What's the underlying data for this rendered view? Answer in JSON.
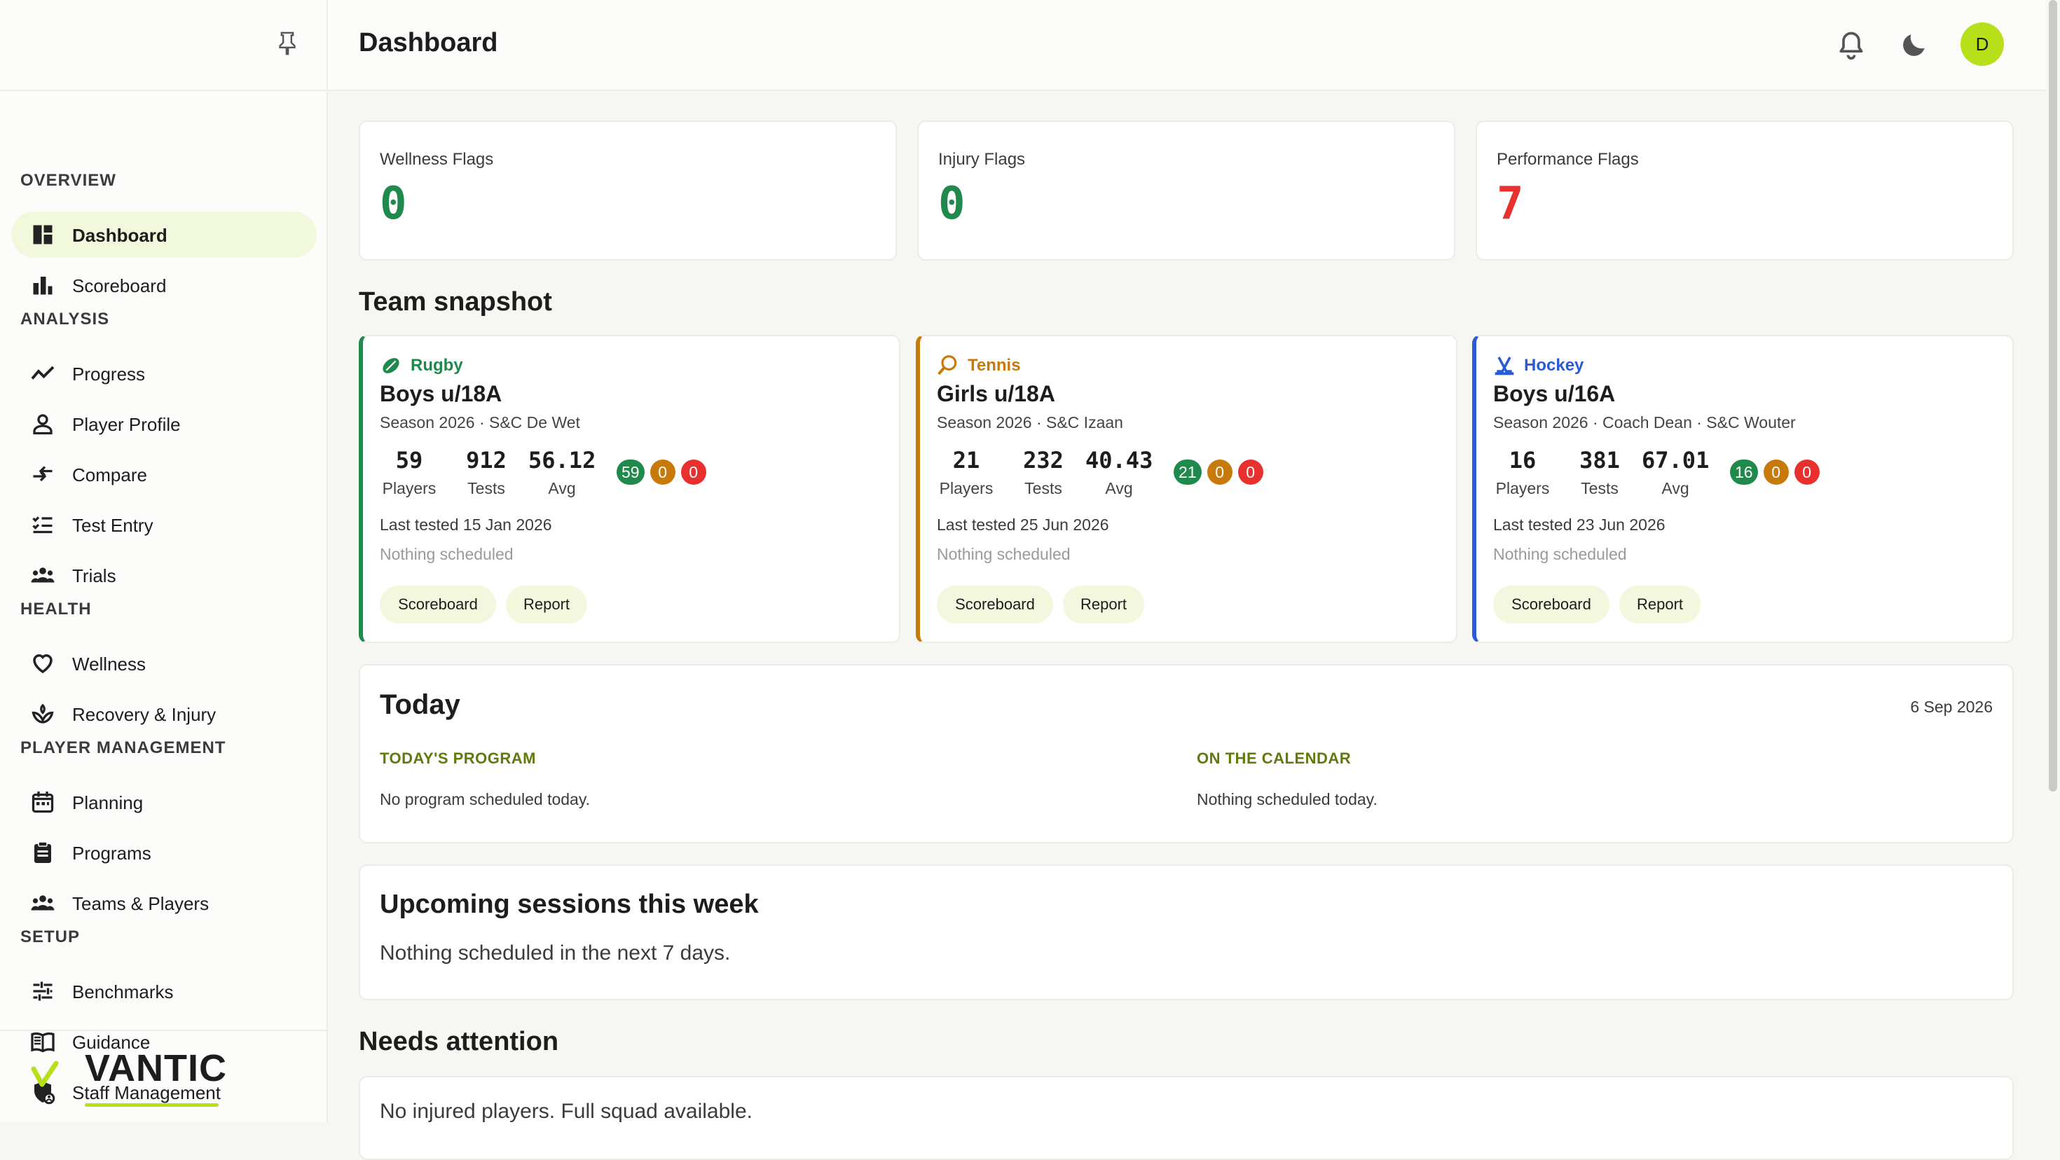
{
  "sidebar": {
    "sections": [
      {
        "title": "OVERVIEW",
        "items": [
          {
            "label": "Dashboard",
            "icon": "dashboard-icon",
            "active": true
          },
          {
            "label": "Scoreboard",
            "icon": "bar-chart-icon"
          }
        ]
      },
      {
        "title": "ANALYSIS",
        "items": [
          {
            "label": "Progress",
            "icon": "trend-line-icon"
          },
          {
            "label": "Player Profile",
            "icon": "person-icon"
          },
          {
            "label": "Compare",
            "icon": "compare-arrows-icon"
          },
          {
            "label": "Test Entry",
            "icon": "checklist-icon"
          },
          {
            "label": "Trials",
            "icon": "group-icon"
          }
        ]
      },
      {
        "title": "HEALTH",
        "items": [
          {
            "label": "Wellness",
            "icon": "heart-icon"
          },
          {
            "label": "Recovery & Injury",
            "icon": "recovery-icon"
          }
        ]
      },
      {
        "title": "PLAYER MANAGEMENT",
        "items": [
          {
            "label": "Planning",
            "icon": "calendar-icon"
          },
          {
            "label": "Programs",
            "icon": "clipboard-icon"
          },
          {
            "label": "Teams & Players",
            "icon": "group-icon"
          }
        ]
      },
      {
        "title": "SETUP",
        "items": [
          {
            "label": "Benchmarks",
            "icon": "sliders-icon"
          },
          {
            "label": "Guidance",
            "icon": "book-icon"
          },
          {
            "label": "Staff Management",
            "icon": "shield-person-icon"
          }
        ]
      }
    ],
    "brand": "VANTIC",
    "brand_color": "#b8e01a"
  },
  "header": {
    "title": "Dashboard",
    "avatar_initial": "D"
  },
  "flags": [
    {
      "label": "Wellness Flags",
      "value": "0",
      "color": "#1f8a4c"
    },
    {
      "label": "Injury Flags",
      "value": "0",
      "color": "#1f8a4c"
    },
    {
      "label": "Performance Flags",
      "value": "7",
      "color": "#e8312f"
    }
  ],
  "team_snapshot": {
    "title": "Team snapshot",
    "teams": [
      {
        "sport": "Rugby",
        "sport_color": "#1f8a4c",
        "name": "Boys u/18A",
        "sub": "Season 2026 · S&C De Wet",
        "stats": [
          {
            "num": "59",
            "cap": "Players"
          },
          {
            "num": "912",
            "cap": "Tests"
          },
          {
            "num": "56.12",
            "cap": "Avg"
          }
        ],
        "badges": [
          "59",
          "0",
          "0"
        ],
        "last_tested": "Last tested 15 Jan 2026",
        "scheduled": "Nothing scheduled",
        "buttons": [
          "Scoreboard",
          "Report"
        ]
      },
      {
        "sport": "Tennis",
        "sport_color": "#c77a0a",
        "name": "Girls u/18A",
        "sub": "Season 2026 · S&C Izaan",
        "stats": [
          {
            "num": "21",
            "cap": "Players"
          },
          {
            "num": "232",
            "cap": "Tests"
          },
          {
            "num": "40.43",
            "cap": "Avg"
          }
        ],
        "badges": [
          "21",
          "0",
          "0"
        ],
        "last_tested": "Last tested 25 Jun 2026",
        "scheduled": "Nothing scheduled",
        "buttons": [
          "Scoreboard",
          "Report"
        ]
      },
      {
        "sport": "Hockey",
        "sport_color": "#2a5bd7",
        "name": "Boys u/16A",
        "sub": "Season 2026 · Coach Dean · S&C Wouter",
        "stats": [
          {
            "num": "16",
            "cap": "Players"
          },
          {
            "num": "381",
            "cap": "Tests"
          },
          {
            "num": "67.01",
            "cap": "Avg"
          }
        ],
        "badges": [
          "16",
          "0",
          "0"
        ],
        "last_tested": "Last tested 23 Jun 2026",
        "scheduled": "Nothing scheduled",
        "buttons": [
          "Scoreboard",
          "Report"
        ]
      }
    ],
    "badge_colors": [
      "#1f8a4c",
      "#c77a0a",
      "#e8312f"
    ]
  },
  "today": {
    "title": "Today",
    "date": "6 Sep 2026",
    "program_title": "TODAY'S PROGRAM",
    "program_text": "No program scheduled today.",
    "calendar_title": "ON THE CALENDAR",
    "calendar_text": "Nothing scheduled today."
  },
  "upcoming": {
    "title": "Upcoming sessions this week",
    "text": "Nothing scheduled in the next 7 days."
  },
  "attention": {
    "title": "Needs attention",
    "text": "No injured players. Full squad available."
  }
}
